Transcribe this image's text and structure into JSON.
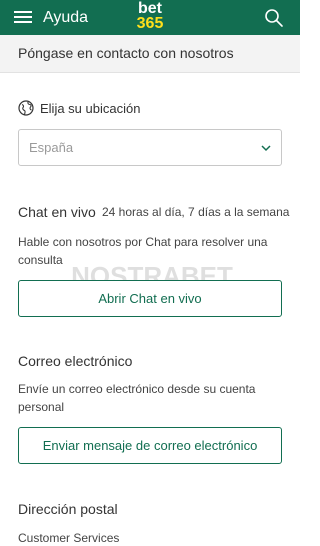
{
  "header": {
    "title": "Ayuda",
    "logo_top": "bet",
    "logo_bottom": "365"
  },
  "subheader": {
    "text": "Póngase en contacto con nosotros"
  },
  "location": {
    "label": "Elija su ubicación",
    "selected": "España"
  },
  "chat": {
    "title": "Chat en vivo",
    "hours": "24 horas al día, 7 días a la semana",
    "description": "Hable con nosotros por Chat para resolver una consulta",
    "button_label": "Abrir Chat en vivo"
  },
  "email": {
    "title": "Correo electrónico",
    "description": "Envíe un correo electrónico desde su cuenta personal",
    "button_label": "Enviar mensaje de correo electrónico"
  },
  "postal": {
    "title": "Dirección postal",
    "line1": "Customer Services"
  },
  "watermark": {
    "text": "NOSTRABET"
  },
  "colors": {
    "brand_green": "#126e51",
    "logo_yellow": "#ffdf1b"
  }
}
